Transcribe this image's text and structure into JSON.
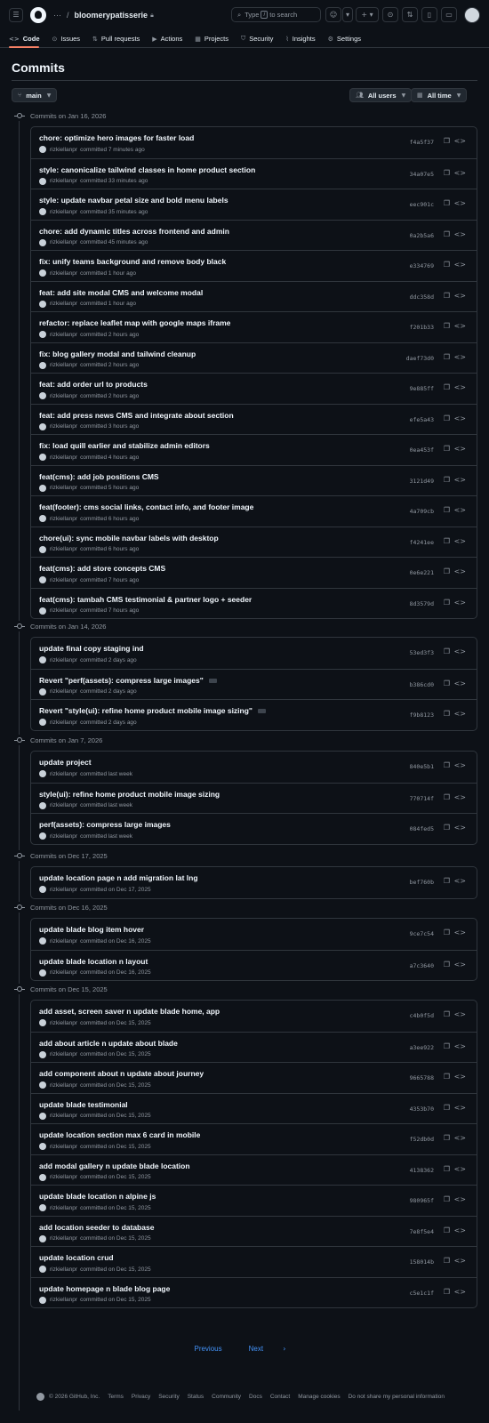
{
  "header": {
    "repo_name": "bloomerypatisserie",
    "search_placeholder_pre": "Type",
    "search_key": "/",
    "search_placeholder_post": "to search"
  },
  "tabs": [
    {
      "label": "Code",
      "icon": "<>"
    },
    {
      "label": "Issues",
      "icon": "⊙"
    },
    {
      "label": "Pull requests",
      "icon": "⇅"
    },
    {
      "label": "Actions",
      "icon": "▶"
    },
    {
      "label": "Projects",
      "icon": "▦"
    },
    {
      "label": "Security",
      "icon": "⛉"
    },
    {
      "label": "Insights",
      "icon": "⌇"
    },
    {
      "label": "Settings",
      "icon": "⚙"
    }
  ],
  "page": {
    "title": "Commits",
    "branch": "main",
    "users_filter": "All users",
    "time_filter": "All time"
  },
  "groups": [
    {
      "date_label": "Commits on Jan 16, 2026",
      "commits": [
        {
          "message": "chore: optimize hero images for faster load",
          "author": "rizkiellanpr",
          "time": "committed 7 minutes ago",
          "sha": "f4a5f37"
        },
        {
          "message": "style: canonicalize tailwind classes in home product section",
          "author": "rizkiellanpr",
          "time": "committed 33 minutes ago",
          "sha": "34a07e5"
        },
        {
          "message": "style: update navbar petal size and bold menu labels",
          "author": "rizkiellanpr",
          "time": "committed 35 minutes ago",
          "sha": "eec901c"
        },
        {
          "message": "chore: add dynamic titles across frontend and admin",
          "author": "rizkiellanpr",
          "time": "committed 45 minutes ago",
          "sha": "0a2b5a6"
        },
        {
          "message": "fix: unify teams background and remove body black",
          "author": "rizkiellanpr",
          "time": "committed 1 hour ago",
          "sha": "e334769"
        },
        {
          "message": "feat: add site modal CMS and welcome modal",
          "author": "rizkiellanpr",
          "time": "committed 1 hour ago",
          "sha": "ddc358d"
        },
        {
          "message": "refactor: replace leaflet map with google maps iframe",
          "author": "rizkiellanpr",
          "time": "committed 2 hours ago",
          "sha": "f201b33"
        },
        {
          "message": "fix: blog gallery modal and tailwind cleanup",
          "author": "rizkiellanpr",
          "time": "committed 2 hours ago",
          "sha": "daef73d0"
        },
        {
          "message": "feat: add order url to products",
          "author": "rizkiellanpr",
          "time": "committed 2 hours ago",
          "sha": "9e885ff"
        },
        {
          "message": "feat: add press news CMS and integrate about section",
          "author": "rizkiellanpr",
          "time": "committed 3 hours ago",
          "sha": "efe5a43"
        },
        {
          "message": "fix: load quill earlier and stabilize admin editors",
          "author": "rizkiellanpr",
          "time": "committed 4 hours ago",
          "sha": "0ea453f"
        },
        {
          "message": "feat(cms): add job positions CMS",
          "author": "rizkiellanpr",
          "time": "committed 5 hours ago",
          "sha": "3121d49"
        },
        {
          "message": "feat(footer): cms social links, contact info, and footer image",
          "author": "rizkiellanpr",
          "time": "committed 6 hours ago",
          "sha": "4a709cb"
        },
        {
          "message": "chore(ui): sync mobile navbar labels with desktop",
          "author": "rizkiellanpr",
          "time": "committed 6 hours ago",
          "sha": "f4241ee"
        },
        {
          "message": "feat(cms): add store concepts CMS",
          "author": "rizkiellanpr",
          "time": "committed 7 hours ago",
          "sha": "0e6e221"
        },
        {
          "message": "feat(cms): tambah CMS testimonial & partner logo + seeder",
          "author": "rizkiellanpr",
          "time": "committed 7 hours ago",
          "sha": "8d3579d"
        }
      ]
    },
    {
      "date_label": "Commits on Jan 14, 2026",
      "commits": [
        {
          "message": "update final copy staging ind",
          "author": "rizkiellanpr",
          "time": "committed 2 days ago",
          "sha": "53ed3f3"
        },
        {
          "message": "Revert \"perf(assets): compress large images\"",
          "author": "rizkiellanpr",
          "time": "committed 2 days ago",
          "sha": "b386cd0",
          "more": true
        },
        {
          "message": "Revert \"style(ui): refine home product mobile image sizing\"",
          "author": "rizkiellanpr",
          "time": "committed 2 days ago",
          "sha": "f9b8123",
          "more": true
        }
      ]
    },
    {
      "date_label": "Commits on Jan 7, 2026",
      "commits": [
        {
          "message": "update project",
          "author": "rizkiellanpr",
          "time": "committed last week",
          "sha": "840e5b1"
        },
        {
          "message": "style(ui): refine home product mobile image sizing",
          "author": "rizkiellanpr",
          "time": "committed last week",
          "sha": "770714f"
        },
        {
          "message": "perf(assets): compress large images",
          "author": "rizkiellanpr",
          "time": "committed last week",
          "sha": "084fed5"
        }
      ]
    },
    {
      "date_label": "Commits on Dec 17, 2025",
      "commits": [
        {
          "message": "update location page n add migration lat lng",
          "author": "rizkiellanpr",
          "time": "committed on Dec 17, 2025",
          "sha": "bef760b"
        }
      ]
    },
    {
      "date_label": "Commits on Dec 16, 2025",
      "commits": [
        {
          "message": "update blade blog item hover",
          "author": "rizkiellanpr",
          "time": "committed on Dec 16, 2025",
          "sha": "9ce7c54"
        },
        {
          "message": "update blade location n layout",
          "author": "rizkiellanpr",
          "time": "committed on Dec 16, 2025",
          "sha": "a7c3640"
        }
      ]
    },
    {
      "date_label": "Commits on Dec 15, 2025",
      "commits": [
        {
          "message": "add asset, screen saver n update blade home, app",
          "author": "rizkiellanpr",
          "time": "committed on Dec 15, 2025",
          "sha": "c4b0f5d"
        },
        {
          "message": "add about article n update about blade",
          "author": "rizkiellanpr",
          "time": "committed on Dec 15, 2025",
          "sha": "a3ee922"
        },
        {
          "message": "add component about n update about journey",
          "author": "rizkiellanpr",
          "time": "committed on Dec 15, 2025",
          "sha": "9665788"
        },
        {
          "message": "update blade testimonial",
          "author": "rizkiellanpr",
          "time": "committed on Dec 15, 2025",
          "sha": "4353b70"
        },
        {
          "message": "update location section max 6 card in mobile",
          "author": "rizkiellanpr",
          "time": "committed on Dec 15, 2025",
          "sha": "f52db0d"
        },
        {
          "message": "add modal gallery n update blade location",
          "author": "rizkiellanpr",
          "time": "committed on Dec 15, 2025",
          "sha": "4138362"
        },
        {
          "message": "update blade location n alpine js",
          "author": "rizkiellanpr",
          "time": "committed on Dec 15, 2025",
          "sha": "980965f"
        },
        {
          "message": "add location seeder to database",
          "author": "rizkiellanpr",
          "time": "committed on Dec 15, 2025",
          "sha": "7e8f5e4"
        },
        {
          "message": "update location crud",
          "author": "rizkiellanpr",
          "time": "committed on Dec 15, 2025",
          "sha": "158014b"
        },
        {
          "message": "update homepage n blade blog page",
          "author": "rizkiellanpr",
          "time": "committed on Dec 15, 2025",
          "sha": "c5e1c1f"
        }
      ]
    }
  ],
  "pagination": {
    "previous": "Previous",
    "next": "Next"
  },
  "footer": {
    "copyright": "© 2026 GitHub, Inc.",
    "links": [
      "Terms",
      "Privacy",
      "Security",
      "Status",
      "Community",
      "Docs",
      "Contact",
      "Manage cookies",
      "Do not share my personal information"
    ]
  }
}
